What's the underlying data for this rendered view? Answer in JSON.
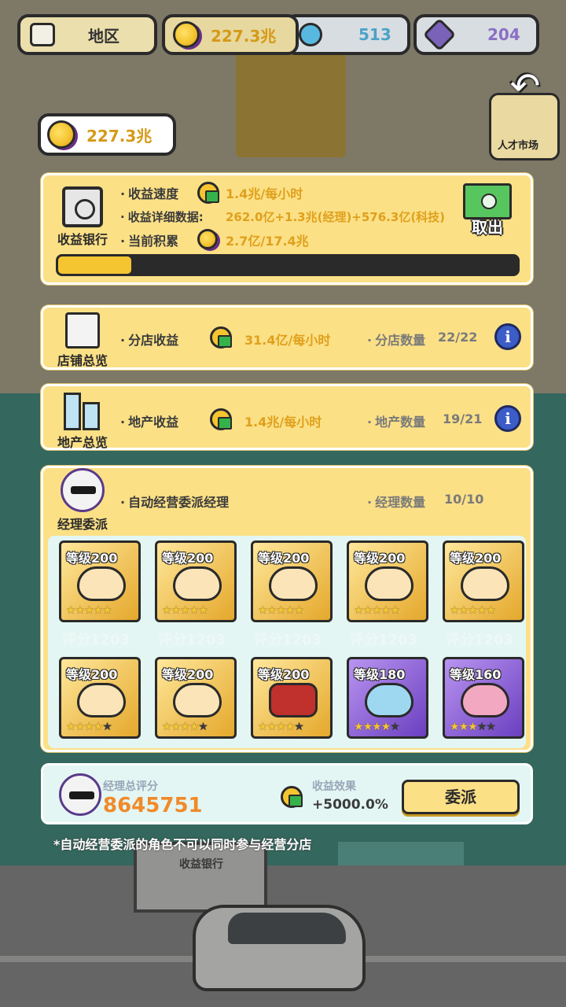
{
  "topbar": {
    "region": "地区",
    "coins": "227.3兆",
    "gems": "513",
    "crystals": "204"
  },
  "talent_label": "人才市场",
  "balance": "227.3兆",
  "bank": {
    "caption": "收益银行",
    "speed_label": "收益速度",
    "speed_value": "1.4兆/每小时",
    "detail_label": "收益详细数据:",
    "detail_value": "262.0亿+1.3兆(经理)+576.3亿(科技)",
    "accum_label": "当前积累",
    "accum_value": "2.7亿/17.4兆",
    "withdraw": "取出",
    "progress": 0.16
  },
  "shops": {
    "caption": "店铺总览",
    "income_label": "分店收益",
    "income_value": "31.4亿/每小时",
    "count_label": "分店数量",
    "count_value": "22/22"
  },
  "estate": {
    "caption": "地产总览",
    "income_label": "地产收益",
    "income_value": "1.4兆/每小时",
    "count_label": "地产数量",
    "count_value": "19/21"
  },
  "manager": {
    "caption": "经理委派",
    "auto_label": "自动经营委派经理",
    "count_label": "经理数量",
    "count_value": "10/10",
    "score_ghost": "评分1203",
    "tiles": [
      {
        "level": "等级200",
        "stars": 5,
        "style": "gold",
        "face": "cat"
      },
      {
        "level": "等级200",
        "stars": 5,
        "style": "gold",
        "face": "cat"
      },
      {
        "level": "等级200",
        "stars": 5,
        "style": "gold",
        "face": "cat"
      },
      {
        "level": "等级200",
        "stars": 5,
        "style": "gold",
        "face": "cat"
      },
      {
        "level": "等级200",
        "stars": 5,
        "style": "gold",
        "face": "cat"
      },
      {
        "level": "等级200",
        "stars": 4,
        "style": "gold",
        "face": "cat"
      },
      {
        "level": "等级200",
        "stars": 4,
        "style": "gold",
        "face": "cat"
      },
      {
        "level": "等级200",
        "stars": 4,
        "style": "gold",
        "face": "robot"
      },
      {
        "level": "等级180",
        "stars": 4,
        "style": "purple",
        "face": "blue"
      },
      {
        "level": "等级160",
        "stars": 3,
        "style": "purple",
        "face": "pink"
      }
    ]
  },
  "summary": {
    "total_label": "经理总评分",
    "total_value": "8645751",
    "effect_label": "收益效果",
    "effect_value": "+5000.0%",
    "assign_button": "委派"
  },
  "footnote": "*自动经营委派的角色不可以同时参与经营分店",
  "background": {
    "building_label": "收益银行"
  }
}
